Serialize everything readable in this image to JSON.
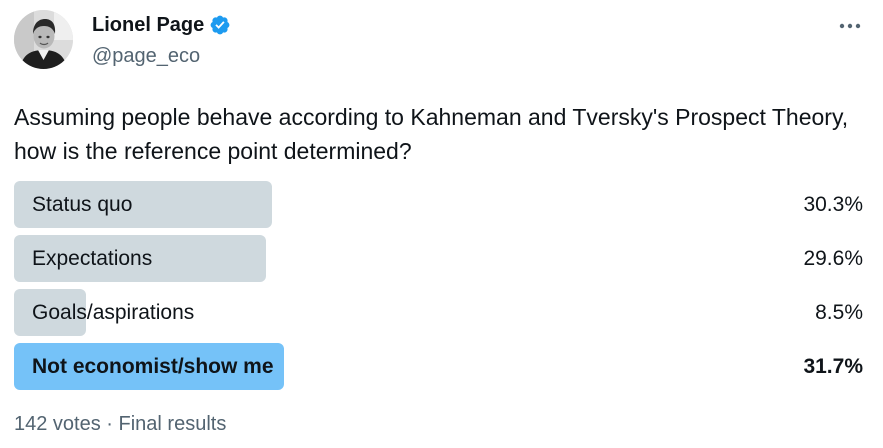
{
  "author": {
    "display_name": "Lionel Page",
    "handle": "@page_eco",
    "avatar_icon": "profile-photo",
    "verified_icon": "verified-badge-icon",
    "verified_color": "#1d9bf0"
  },
  "more_icon": "more-options-icon",
  "tweet": {
    "text": "Assuming people behave according to Kahneman and Tversky's Prospect Theory, how is the reference point determined?"
  },
  "poll": {
    "options": [
      {
        "label": "Status quo",
        "percent_text": "30.3%",
        "percent": 30.3,
        "winner": false
      },
      {
        "label": "Expectations",
        "percent_text": "29.6%",
        "percent": 29.6,
        "winner": false
      },
      {
        "label": "Goals/aspirations",
        "percent_text": "8.5%",
        "percent": 8.5,
        "winner": false
      },
      {
        "label": "Not economist/show me",
        "percent_text": "31.7%",
        "percent": 31.7,
        "winner": true
      }
    ],
    "footer": "142 votes · Final results",
    "bar_color": "#cfd9de",
    "winner_bar_color": "#75c2f8"
  }
}
